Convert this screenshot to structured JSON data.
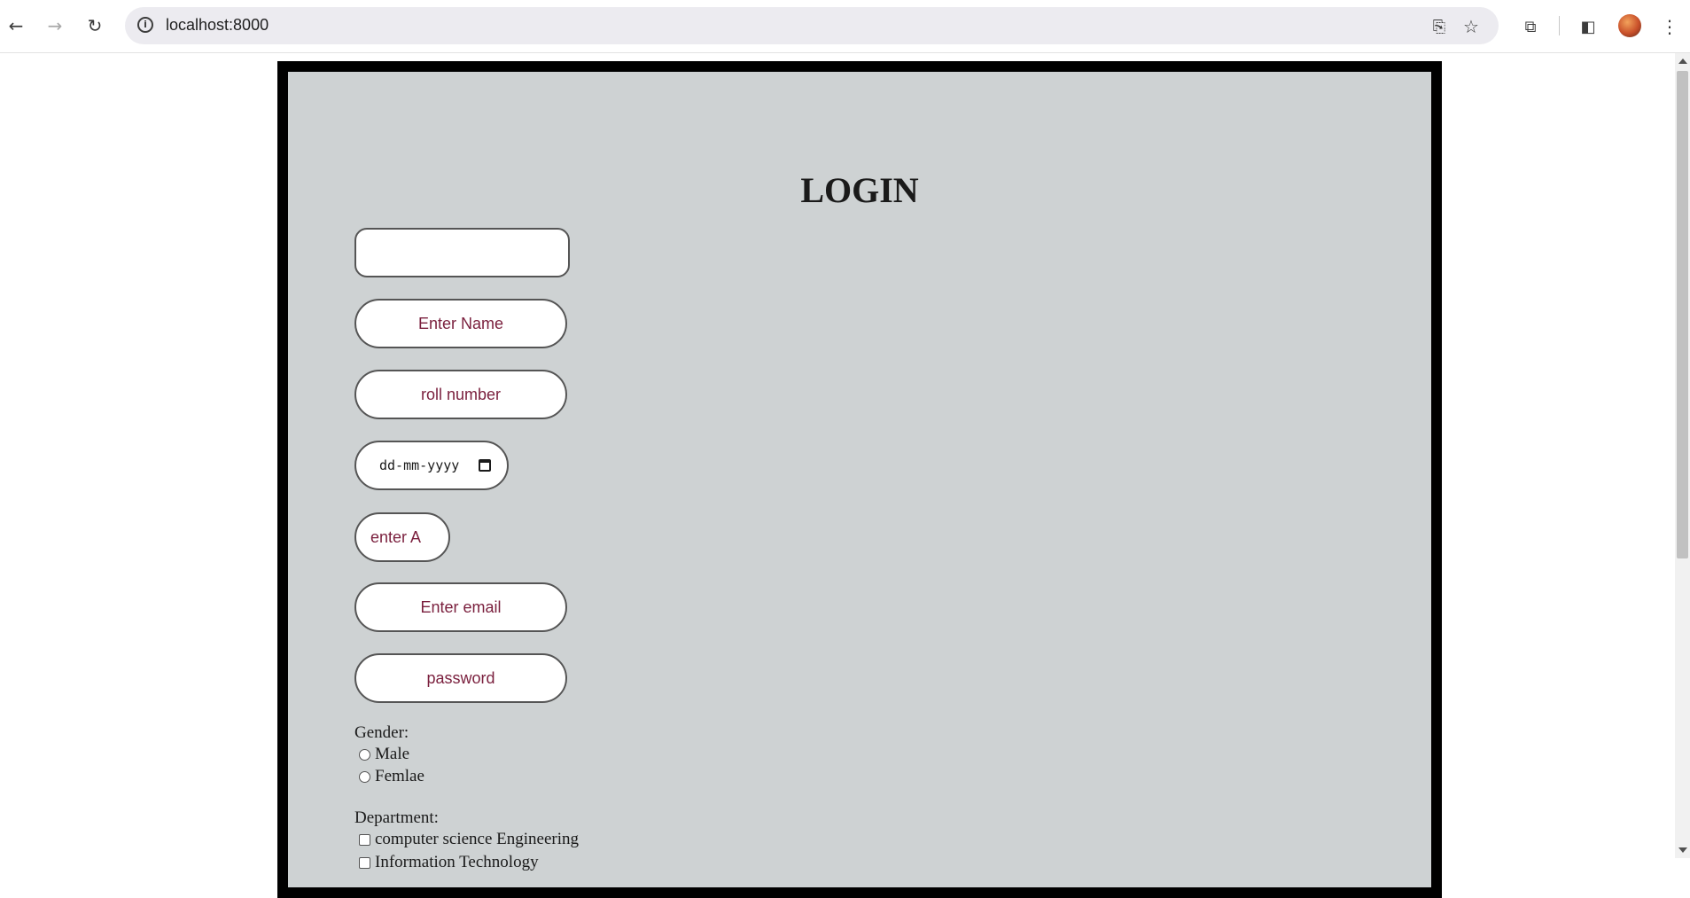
{
  "browser": {
    "url": "localhost:8000"
  },
  "page": {
    "title": "LOGIN",
    "fields": {
      "top_value": "",
      "name_placeholder": "Enter Name",
      "roll_placeholder": "roll number",
      "date_placeholder": "dd-mm-yyyy",
      "age_placeholder": "enter A",
      "email_placeholder": "Enter email",
      "password_placeholder": "password"
    },
    "gender": {
      "label": "Gender:",
      "options": [
        "Male",
        "Femlae"
      ]
    },
    "department": {
      "label": "Department:",
      "options": [
        "computer science Engineering",
        "Information Technology"
      ]
    }
  }
}
